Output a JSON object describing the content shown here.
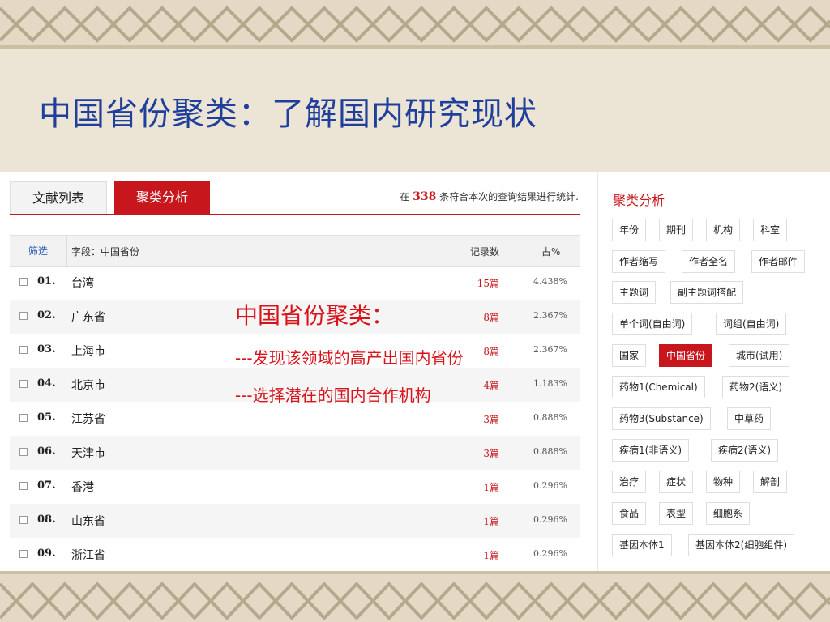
{
  "slide": {
    "title": "中国省份聚类：了解国内研究现状"
  },
  "tabs": [
    {
      "label": "文献列表",
      "active": false
    },
    {
      "label": "聚类分析",
      "active": true
    }
  ],
  "stats": {
    "prefix": "在",
    "count": "338",
    "suffix": "条符合本次的查询结果进行统计."
  },
  "table": {
    "headers": {
      "filter": "筛选",
      "field": "字段：中国省份",
      "count": "记录数",
      "percent": "占%"
    },
    "rows": [
      {
        "idx": "01.",
        "name": "台湾",
        "count": "15篇",
        "pct": "4.438%"
      },
      {
        "idx": "02.",
        "name": "广东省",
        "count": "8篇",
        "pct": "2.367%"
      },
      {
        "idx": "03.",
        "name": "上海市",
        "count": "8篇",
        "pct": "2.367%"
      },
      {
        "idx": "04.",
        "name": "北京市",
        "count": "4篇",
        "pct": "1.183%"
      },
      {
        "idx": "05.",
        "name": "江苏省",
        "count": "3篇",
        "pct": "0.888%"
      },
      {
        "idx": "06.",
        "name": "天津市",
        "count": "3篇",
        "pct": "0.888%"
      },
      {
        "idx": "07.",
        "name": "香港",
        "count": "1篇",
        "pct": "0.296%"
      },
      {
        "idx": "08.",
        "name": "山东省",
        "count": "1篇",
        "pct": "0.296%"
      },
      {
        "idx": "09.",
        "name": "浙江省",
        "count": "1篇",
        "pct": "0.296%"
      }
    ]
  },
  "overlay": {
    "title": "中国省份聚类：",
    "line1": "---发现该领域的高产出国内省份",
    "line2": "---选择潜在的国内合作机构"
  },
  "panel": {
    "title": "聚类分析",
    "tags": [
      [
        "年份",
        "期刊",
        "机构",
        "科室"
      ],
      [
        "作者缩写",
        "作者全名",
        "作者邮件"
      ],
      [
        "主题词",
        "副主题词搭配"
      ],
      [
        "单个词(自由词)",
        "词组(自由词)"
      ],
      [
        "国家",
        "中国省份",
        "城市(试用)"
      ],
      [
        "药物1(Chemical)",
        "药物2(语义)"
      ],
      [
        "药物3(Substance)",
        "中草药"
      ],
      [
        "疾病1(非语义)",
        "疾病2(语义)"
      ],
      [
        "治疗",
        "症状",
        "物种",
        "解剖"
      ],
      [
        "食品",
        "表型",
        "细胞系"
      ],
      [
        "基因本体1",
        "基因本体2(细胞组件)"
      ]
    ],
    "selected": "中国省份"
  },
  "colors": {
    "accent": "#c8161d",
    "title": "#1f3f9c",
    "overlay": "#d8141b"
  }
}
